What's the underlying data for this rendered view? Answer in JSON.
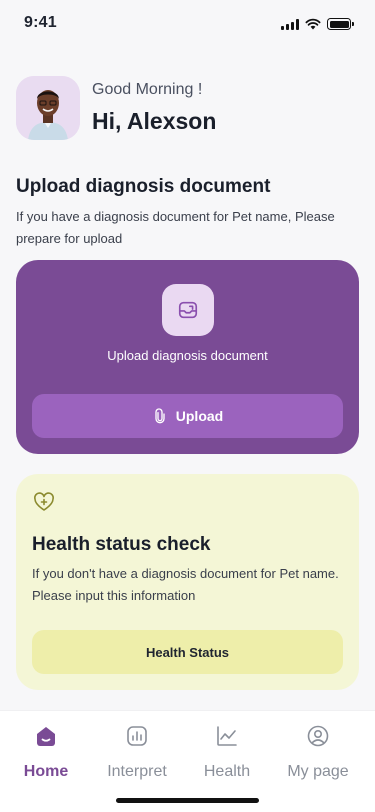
{
  "status_bar": {
    "time": "9:41",
    "signal_icon": "cellular-signal-icon",
    "wifi_icon": "wifi-icon",
    "battery_icon": "battery-icon"
  },
  "greeting": {
    "subtitle": "Good Morning !",
    "name": "Hi, Alexson",
    "avatar_icon": "avatar-photo"
  },
  "upload_section": {
    "title": "Upload diagnosis document",
    "description": "If you have a diagnosis document for Pet name, Please prepare for upload",
    "card": {
      "icon": "document-upload-icon",
      "label": "Upload diagnosis document",
      "button_label": "Upload",
      "button_icon": "paperclip-icon"
    }
  },
  "health_card": {
    "icon": "heart-plus-icon",
    "title": "Health status check",
    "description": "If you don't have a diagnosis document for Pet name. Please input this information",
    "button_label": "Health Status"
  },
  "bottom_nav": {
    "items": [
      {
        "label": "Home",
        "icon": "home-icon",
        "active": true
      },
      {
        "label": "Interpret",
        "icon": "chart-bars-icon",
        "active": false
      },
      {
        "label": "Health",
        "icon": "line-chart-icon",
        "active": false
      },
      {
        "label": "My page",
        "icon": "user-circle-icon",
        "active": false
      }
    ]
  },
  "colors": {
    "primary": "#7a4b95",
    "primary_light": "#9b63be",
    "accent_bg": "#f4f6d6",
    "accent_button": "#eeeeaa",
    "background": "#f7f7f9"
  }
}
